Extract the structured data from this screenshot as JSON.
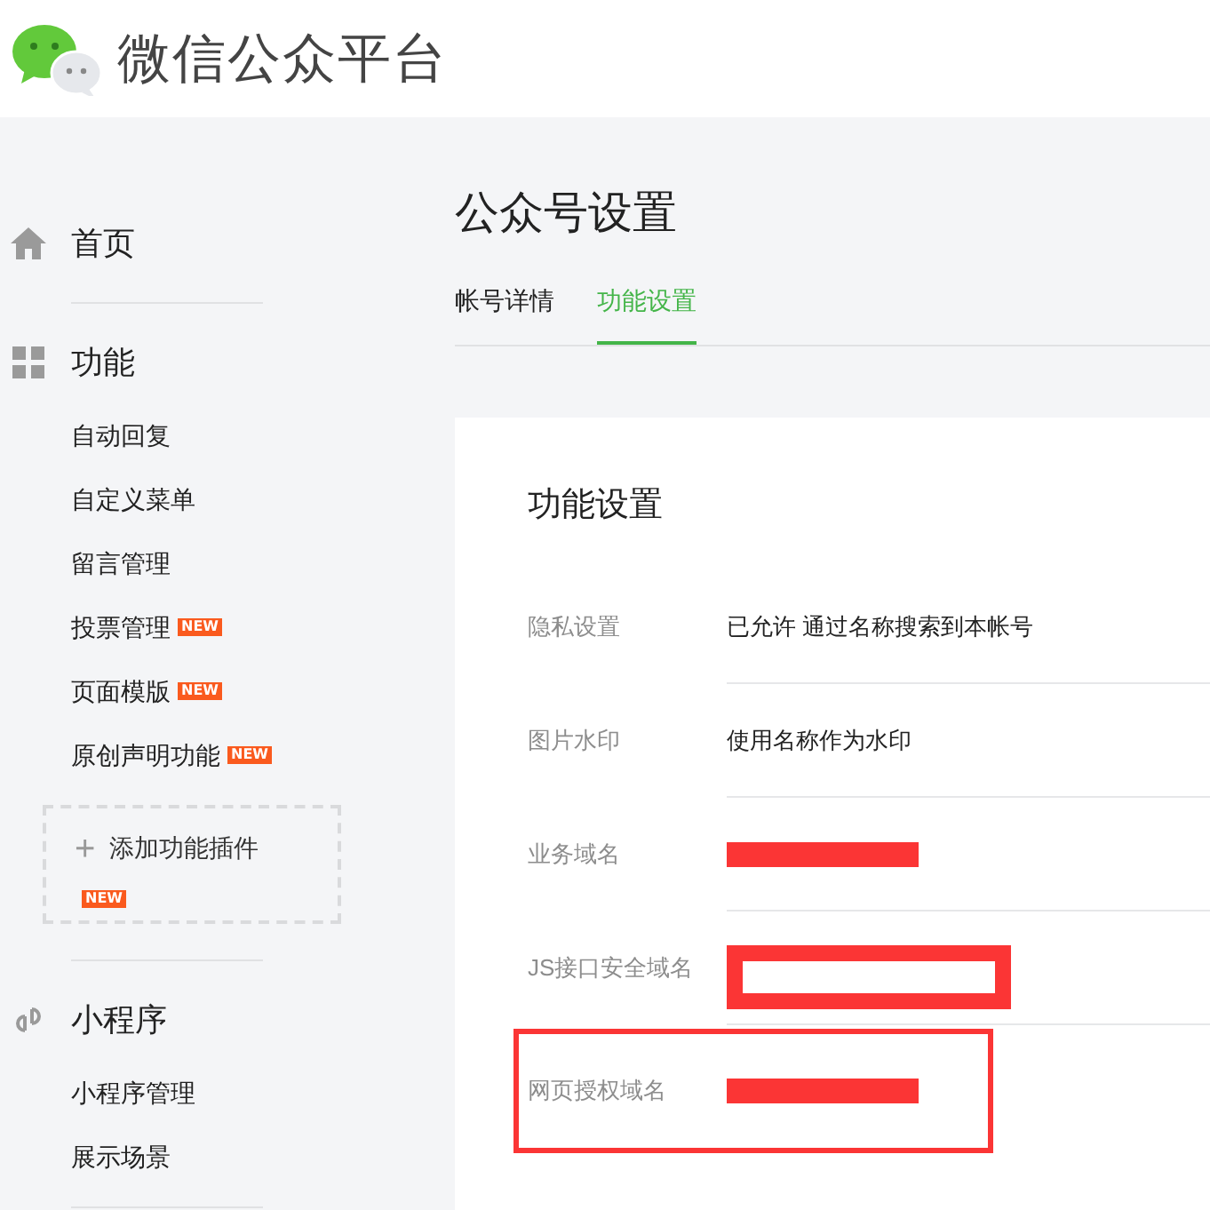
{
  "header": {
    "title": "微信公众平台"
  },
  "sidebar": {
    "sections": [
      {
        "label": "首页"
      },
      {
        "label": "功能",
        "items": [
          {
            "label": "自动回复"
          },
          {
            "label": "自定义菜单"
          },
          {
            "label": "留言管理"
          },
          {
            "label": "投票管理",
            "badge": "NEW"
          },
          {
            "label": "页面模版",
            "badge": "NEW"
          },
          {
            "label": "原创声明功能",
            "badge": "NEW"
          }
        ],
        "add_plugin": {
          "icon": "+",
          "label": "添加功能插件",
          "badge": "NEW"
        }
      },
      {
        "label": "小程序",
        "items": [
          {
            "label": "小程序管理"
          },
          {
            "label": "展示场景"
          }
        ]
      }
    ]
  },
  "main": {
    "title": "公众号设置",
    "tabs": [
      {
        "label": "帐号详情",
        "selected": false
      },
      {
        "label": "功能设置",
        "selected": true
      }
    ],
    "card": {
      "title": "功能设置",
      "rows": [
        {
          "label": "隐私设置",
          "kind": "text",
          "value": "已允许 通过名称搜索到本帐号",
          "highlighted": false
        },
        {
          "label": "图片水印",
          "kind": "text",
          "value": "使用名称作为水印",
          "highlighted": false
        },
        {
          "label": "业务域名",
          "kind": "redacted",
          "highlighted": false
        },
        {
          "label": "JS接口安全域名",
          "kind": "redacted_frame",
          "highlighted": false
        },
        {
          "label": "网页授权域名",
          "kind": "redacted",
          "highlighted": true
        }
      ]
    }
  }
}
